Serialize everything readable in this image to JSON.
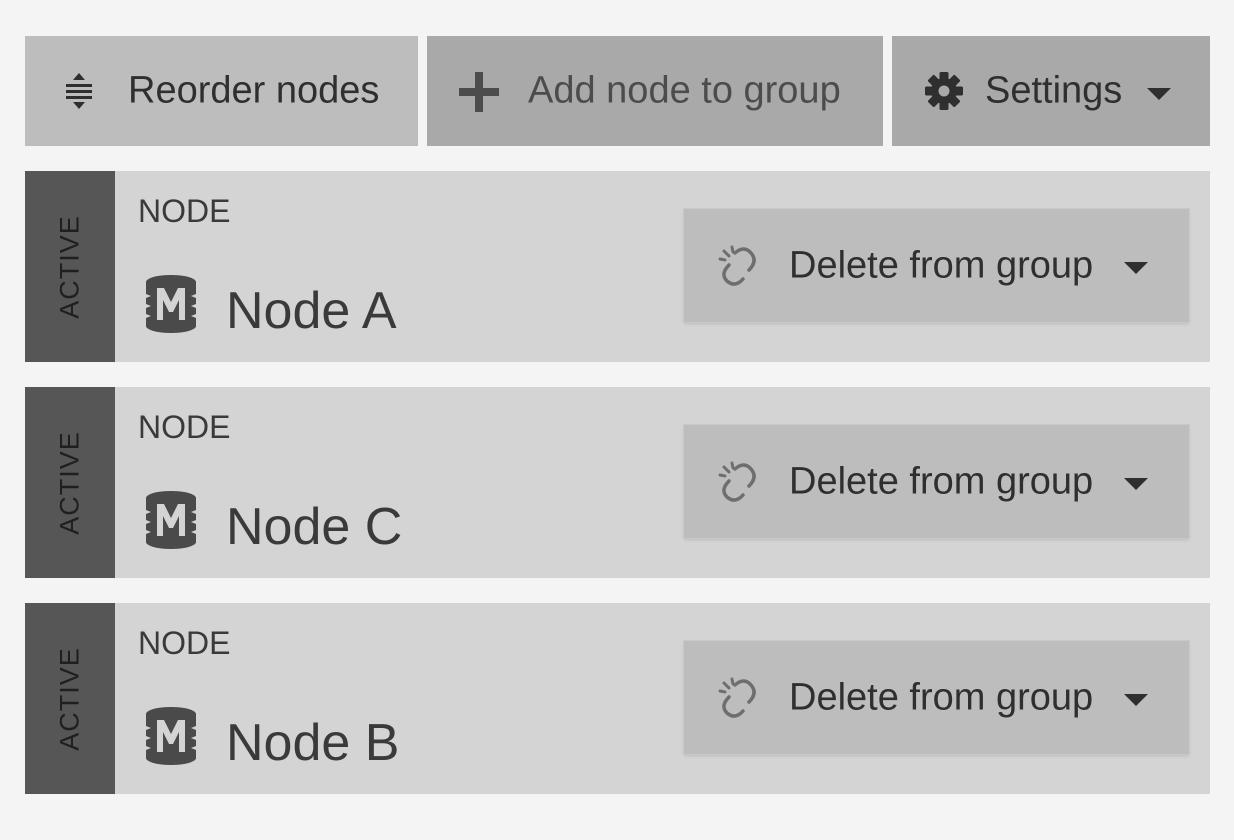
{
  "toolbar": {
    "reorder_label": "Reorder nodes",
    "reorder_icon": "reorder-icon",
    "add_label": "Add node to group",
    "add_icon": "plus-icon",
    "settings_label": "Settings",
    "settings_icon": "gear-icon"
  },
  "nodes": [
    {
      "status": "ACTIVE",
      "kind": "NODE",
      "name": "Node A",
      "icon": "database-m-icon",
      "action_label": "Delete from group",
      "action_icon": "unlink-icon"
    },
    {
      "status": "ACTIVE",
      "kind": "NODE",
      "name": "Node C",
      "icon": "database-m-icon",
      "action_label": "Delete from group",
      "action_icon": "unlink-icon"
    },
    {
      "status": "ACTIVE",
      "kind": "NODE",
      "name": "Node B",
      "icon": "database-m-icon",
      "action_label": "Delete from group",
      "action_icon": "unlink-icon"
    }
  ],
  "colors": {
    "page_bg": "#f4f4f4",
    "card_bg": "#d4d4d4",
    "status_strip": "#565656",
    "button_bg": "#bdbdbd",
    "button_bg_dark": "#a9a9a9",
    "text": "#3a3a3a"
  }
}
